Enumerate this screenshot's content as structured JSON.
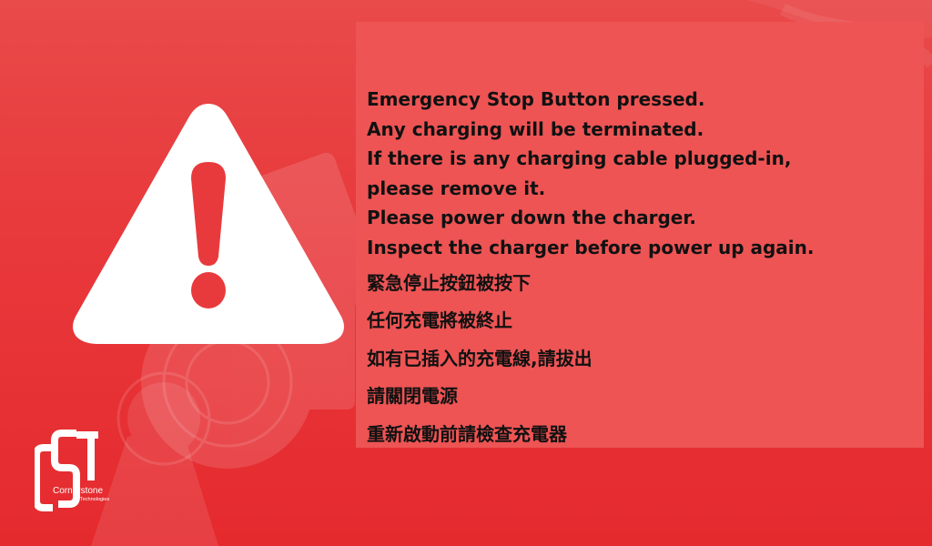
{
  "alert": {
    "icon": "warning-triangle-icon",
    "english_lines": [
      "Emergency Stop Button pressed.",
      "Any charging will be terminated.",
      "If there is any charging cable plugged-in,",
      "please remove it.",
      "Please power down the charger.",
      "Inspect the charger before power up again."
    ],
    "chinese_lines": [
      "緊急停止按鈕被按下",
      "任何充電將被終止",
      "如有已插入的充電線,請拔出",
      "請關閉電源",
      "重新啟動前請檢查充電器"
    ]
  },
  "logo": {
    "mark": "CST",
    "name": "Cornerstone",
    "subtitle": "Technologies"
  },
  "colors": {
    "background": "#e8383b",
    "panel": "#ee5454",
    "text": "#111111",
    "icon": "#ffffff"
  }
}
